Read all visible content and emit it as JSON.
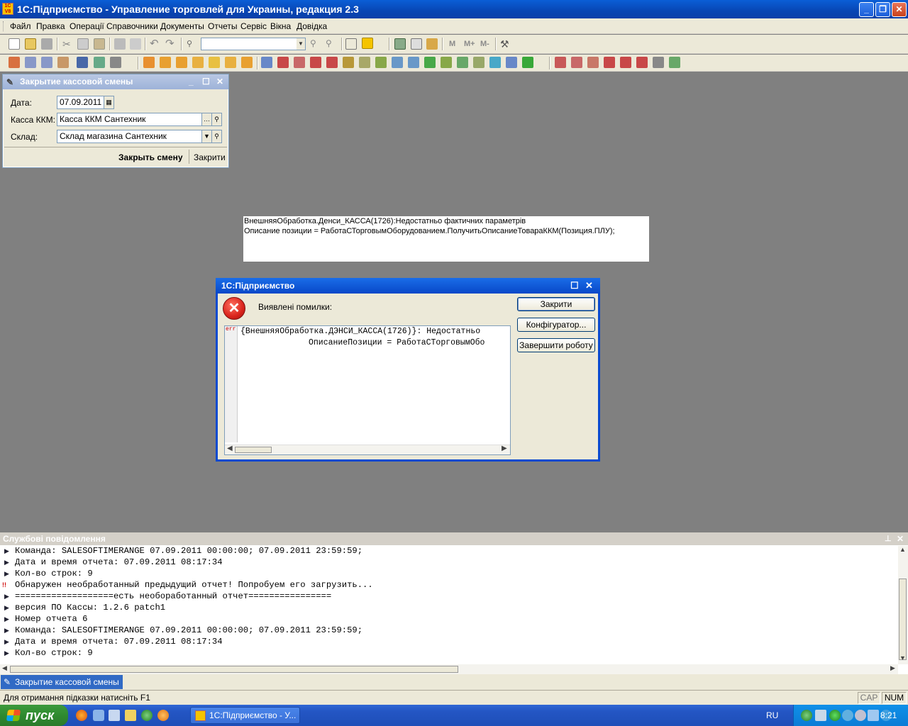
{
  "app": {
    "title": "1С:Підприємство - Управление торговлей для Украины, редакция 2.3",
    "logo_text": "1С V8"
  },
  "menubar": {
    "items": [
      "Файл",
      "Правка",
      "Операції",
      "Справочники",
      "Документы",
      "Отчеты",
      "Сервіс",
      "Вікна",
      "Довідка"
    ]
  },
  "toolbar": {
    "memory_buttons": [
      "M",
      "M+",
      "M-"
    ],
    "search_value": ""
  },
  "form": {
    "title": "Закрытие кассовой смены",
    "date_label": "Дата:",
    "date_value": "07.09.2011",
    "kassa_label": "Касса ККМ:",
    "kassa_value": "Касса ККМ Сантехник",
    "sklad_label": "Склад:",
    "sklad_value": "Склад магазина Сантехник",
    "close_shift_button": "Закрыть смену",
    "close_button": "Закрити"
  },
  "error_panel": {
    "line1": "ВнешняяОбработка.Денси_КАССА(1726):Недостатньо фактичних параметрів",
    "line2": "Описание позиции = РаботаСТорговымОборудованием.ПолучитьОписаниеТовараККМ(Позиция.ПЛУ);"
  },
  "dialog": {
    "title": "1С:Підприємство",
    "message": "Виявлені помилки:",
    "err_marker": "err",
    "code_line1": "{ВнешняяОбработка.ДЭНСИ_КАССА(1726)}: Недостатньо",
    "code_line2": "ОписаниеПозиции = РаботаСТорговымОбо",
    "buttons": {
      "close": "Закрити",
      "configurator": "Конфігуратор...",
      "exit": "Завершити роботу"
    }
  },
  "messages": {
    "title": "Службові повідомлення",
    "lines": [
      {
        "mark": "info",
        "text": "Команда: SALESOFTIMERANGE 07.09.2011 00:00:00; 07.09.2011 23:59:59;"
      },
      {
        "mark": "info",
        "text": "Дата и время отчета: 07.09.2011 08:17:34"
      },
      {
        "mark": "info",
        "text": "Кол-во строк: 9"
      },
      {
        "mark": "error",
        "text": "Обнаружен необработанный предыдущий отчет! Попробуем его загрузить..."
      },
      {
        "mark": "info",
        "text": "===================есть необоработанный отчет================"
      },
      {
        "mark": "info",
        "text": "версия ПО Кассы: 1.2.6 patch1"
      },
      {
        "mark": "info",
        "text": "Номер отчета 6"
      },
      {
        "mark": "info",
        "text": "Команда: SALESOFTIMERANGE 07.09.2011 00:00:00; 07.09.2011 23:59:59;"
      },
      {
        "mark": "info",
        "text": "Дата и время отчета: 07.09.2011 08:17:34"
      },
      {
        "mark": "info",
        "text": "Кол-во строк: 9"
      }
    ]
  },
  "window_tab": {
    "label": "Закрытие кассовой смены"
  },
  "statusbar": {
    "hint": "Для отримання підказки натисніть F1",
    "cap": "CAP",
    "num": "NUM"
  },
  "taskbar": {
    "start_label": "пуск",
    "task_button": "1С:Підприємство - У...",
    "lang": "RU",
    "clock": "8:21"
  },
  "colors": {
    "xp_blue": "#0a5ed6",
    "error_red": "#d9241c",
    "start_green": "#3c9a3c",
    "mdi_gray": "#808080"
  }
}
